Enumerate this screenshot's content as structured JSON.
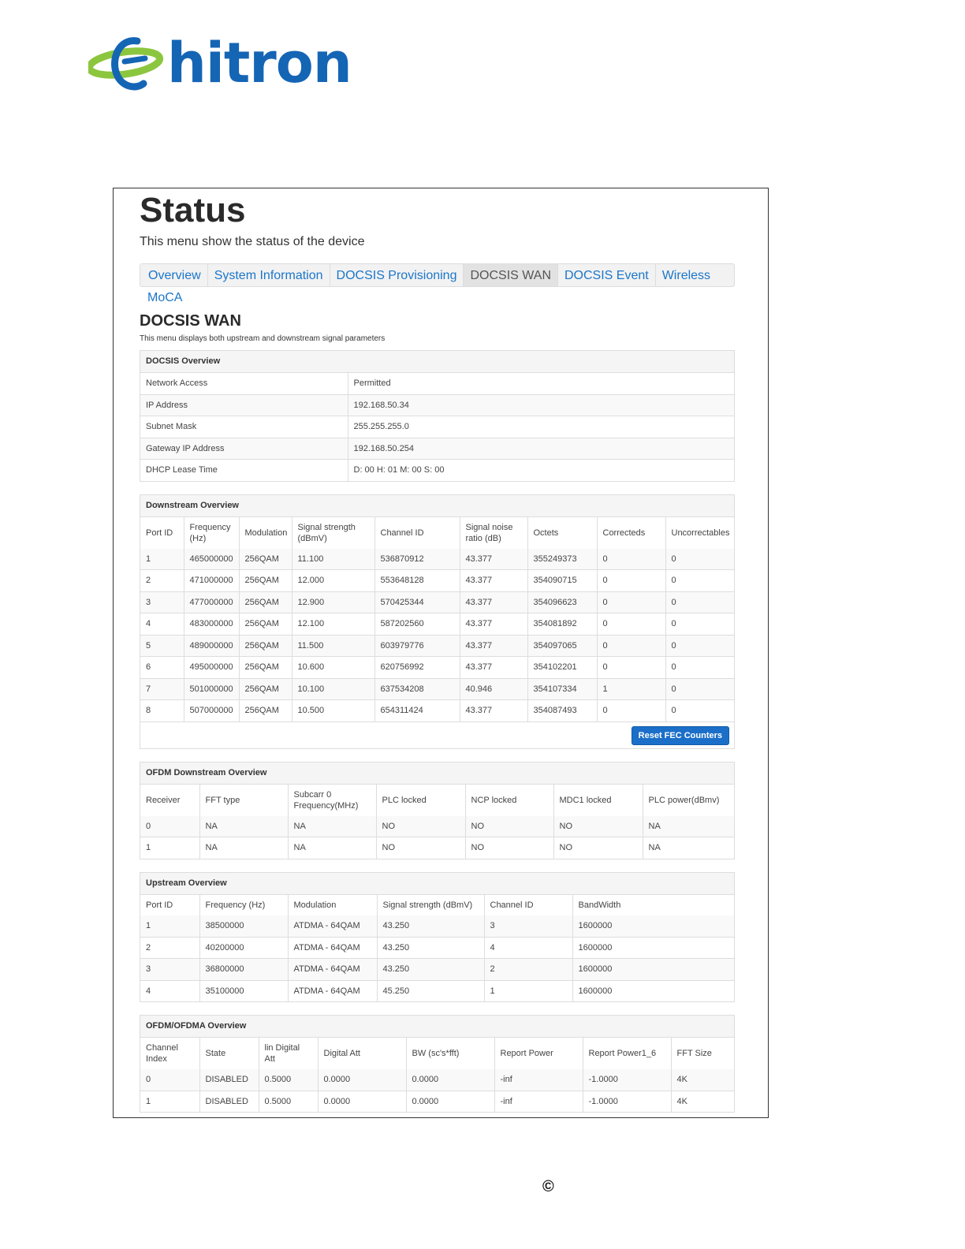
{
  "brand": {
    "name": "hitron",
    "color": "#1565b5",
    "accent": "#8cc63f"
  },
  "header": {
    "title": "Status",
    "subtitle": "This menu show the status of the device"
  },
  "tabs": [
    {
      "label": "Overview",
      "active": false
    },
    {
      "label": "System Information",
      "active": false
    },
    {
      "label": "DOCSIS Provisioning",
      "active": false
    },
    {
      "label": "DOCSIS WAN",
      "active": true
    },
    {
      "label": "DOCSIS Event",
      "active": false
    },
    {
      "label": "Wireless",
      "active": false
    },
    {
      "label": "MoCA",
      "active": false
    }
  ],
  "section": {
    "title": "DOCSIS WAN",
    "subtitle": "This menu displays both upstream and downstream signal parameters"
  },
  "docsis_overview": {
    "title": "DOCSIS Overview",
    "rows": [
      [
        "Network Access",
        "Permitted"
      ],
      [
        "IP Address",
        "192.168.50.34"
      ],
      [
        "Subnet Mask",
        "255.255.255.0"
      ],
      [
        "Gateway IP Address",
        "192.168.50.254"
      ],
      [
        "DHCP Lease Time",
        "D: 00 H: 01 M: 00 S: 00"
      ]
    ]
  },
  "downstream": {
    "title": "Downstream Overview",
    "headers": [
      "Port ID",
      "Frequency (Hz)",
      "Modulation",
      "Signal strength (dBmV)",
      "Channel ID",
      "Signal noise ratio (dB)",
      "Octets",
      "Correcteds",
      "Uncorrectables"
    ],
    "rows": [
      [
        "1",
        "465000000",
        "256QAM",
        "11.100",
        "536870912",
        "43.377",
        "355249373",
        "0",
        "0"
      ],
      [
        "2",
        "471000000",
        "256QAM",
        "12.000",
        "553648128",
        "43.377",
        "354090715",
        "0",
        "0"
      ],
      [
        "3",
        "477000000",
        "256QAM",
        "12.900",
        "570425344",
        "43.377",
        "354096623",
        "0",
        "0"
      ],
      [
        "4",
        "483000000",
        "256QAM",
        "12.100",
        "587202560",
        "43.377",
        "354081892",
        "0",
        "0"
      ],
      [
        "5",
        "489000000",
        "256QAM",
        "11.500",
        "603979776",
        "43.377",
        "354097065",
        "0",
        "0"
      ],
      [
        "6",
        "495000000",
        "256QAM",
        "10.600",
        "620756992",
        "43.377",
        "354102201",
        "0",
        "0"
      ],
      [
        "7",
        "501000000",
        "256QAM",
        "10.100",
        "637534208",
        "40.946",
        "354107334",
        "1",
        "0"
      ],
      [
        "8",
        "507000000",
        "256QAM",
        "10.500",
        "654311424",
        "43.377",
        "354087493",
        "0",
        "0"
      ]
    ],
    "button": "Reset FEC Counters"
  },
  "ofdm_downstream": {
    "title": "OFDM Downstream Overview",
    "headers": [
      "Receiver",
      "FFT type",
      "Subcarr 0 Frequency(MHz)",
      "PLC locked",
      "NCP locked",
      "MDC1 locked",
      "PLC power(dBmv)"
    ],
    "rows": [
      [
        "0",
        "NA",
        "NA",
        "NO",
        "NO",
        "NO",
        "NA"
      ],
      [
        "1",
        "NA",
        "NA",
        "NO",
        "NO",
        "NO",
        "NA"
      ]
    ]
  },
  "upstream": {
    "title": "Upstream Overview",
    "headers": [
      "Port ID",
      "Frequency (Hz)",
      "Modulation",
      "Signal strength (dBmV)",
      "Channel ID",
      "BandWidth"
    ],
    "rows": [
      [
        "1",
        "38500000",
        "ATDMA -   64QAM",
        "43.250",
        "3",
        "1600000"
      ],
      [
        "2",
        "40200000",
        "ATDMA -   64QAM",
        "43.250",
        "4",
        "1600000"
      ],
      [
        "3",
        "36800000",
        "ATDMA -   64QAM",
        "43.250",
        "2",
        "1600000"
      ],
      [
        "4",
        "35100000",
        "ATDMA -   64QAM",
        "45.250",
        "1",
        "1600000"
      ]
    ]
  },
  "ofdma": {
    "title": "OFDM/OFDMA Overview",
    "headers": [
      "Channel Index",
      "State",
      "lin Digital Att",
      "Digital Att",
      "BW (sc's*fft)",
      "Report Power",
      "Report Power1_6",
      "FFT Size"
    ],
    "rows": [
      [
        "0",
        "DISABLED",
        "0.5000",
        "0.0000",
        "0.0000",
        "-inf",
        "-1.0000",
        "4K"
      ],
      [
        "1",
        "DISABLED",
        "0.5000",
        "0.0000",
        "0.0000",
        "-inf",
        "-1.0000",
        "4K"
      ]
    ]
  },
  "footer": {
    "copyright_symbol": "©"
  }
}
